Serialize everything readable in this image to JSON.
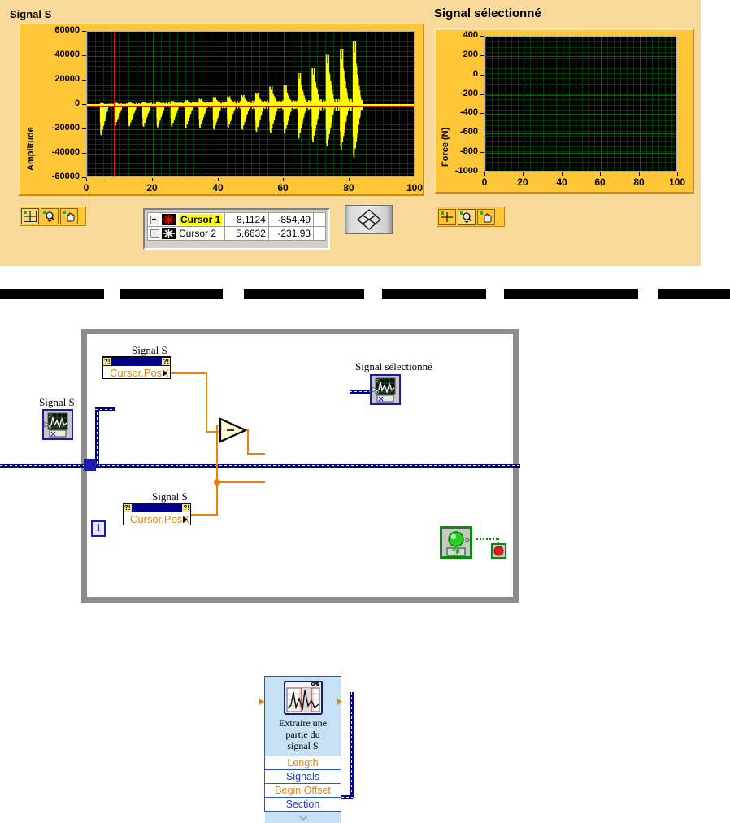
{
  "front_panel": {
    "left_graph": {
      "title": "Signal S",
      "ylabel": "Amplitude",
      "yticks": [
        "60000",
        "40000",
        "20000",
        "0",
        "-20000",
        "-40000",
        "-60000"
      ],
      "xticks": [
        "0",
        "20",
        "40",
        "60",
        "80",
        "100"
      ],
      "ylim": [
        -60000,
        60000
      ],
      "xlim": [
        0,
        100
      ],
      "plot_color": "#FFFF00",
      "bg_color": "#000000",
      "grid_color": "#006400",
      "cursor1_color": "#FF0000",
      "cursor2_color": "#BFEFFF"
    },
    "right_graph": {
      "title": "Signal sélectionné",
      "ylabel": "Force (N)",
      "yticks": [
        "400",
        "200",
        "0",
        "-200",
        "-400",
        "-600",
        "-800",
        "-1000"
      ],
      "xticks": [
        "0",
        "20",
        "40",
        "60",
        "80",
        "100"
      ],
      "ylim": [
        -1000,
        400
      ],
      "xlim": [
        0,
        100
      ],
      "bg_color": "#000000",
      "grid_color": "#006400"
    },
    "left_palette": {
      "tools": [
        "cursor-move-tool",
        "zoom-tool",
        "pan-tool"
      ],
      "selected": "cursor-move-tool"
    },
    "right_palette": {
      "tools": [
        "cursor-move-tool",
        "zoom-tool",
        "pan-tool"
      ],
      "selected": "zoom-tool"
    },
    "cursor_legend": {
      "rows": [
        {
          "name": "Cursor 1",
          "x": "8,1124",
          "y": "-854,49",
          "highlight": true,
          "color": "#FF0000"
        },
        {
          "name": "Cursor 2",
          "x": "5,6632",
          "y": "-231,93",
          "highlight": false,
          "color": "#FFFFFF"
        }
      ]
    },
    "cursor_pad": {
      "name": "cursor-movement-pad"
    }
  },
  "block_diagram": {
    "input_terminal": {
      "label": "Signal S",
      "icon": "waveform-graph-terminal-icon"
    },
    "property_node_1": {
      "label": "Signal S",
      "property": "Cursor.PosX"
    },
    "property_node_2": {
      "label": "Signal S",
      "property": "Cursor.PosX"
    },
    "subtract_node": {
      "symbol": "−",
      "name": "subtract-function"
    },
    "express_vi": {
      "title_lines": [
        "Extraire une",
        "partie du",
        "signal  S"
      ],
      "icon": "extract-signal-icon",
      "terminals": [
        {
          "label": "Length",
          "style": "orange"
        },
        {
          "label": "Signals",
          "style": "blue"
        },
        {
          "label": "Begin Offset",
          "style": "orange"
        },
        {
          "label": "Section",
          "style": "blue"
        }
      ]
    },
    "output_terminal": {
      "label": "Signal sélectionné",
      "icon": "waveform-graph-terminal-icon"
    },
    "iteration_terminal": {
      "label": "i"
    },
    "boolean_terminal": {
      "label": "TF",
      "icon": "green-led-icon"
    },
    "stop_button": {
      "name": "stop-button",
      "icon": "stop-icon",
      "color": "#E01B1B"
    },
    "loop_border_color": "#8C8C8C"
  },
  "chart_data": [
    {
      "type": "line",
      "title": "Signal S",
      "xlabel": "",
      "ylabel": "Amplitude",
      "xlim": [
        0,
        100
      ],
      "ylim": [
        -60000,
        60000
      ],
      "grid": true,
      "legend": "none",
      "annotations": [
        {
          "name": "Cursor 1",
          "x": 8.1124,
          "y": -854.49,
          "color": "#FF0000"
        },
        {
          "name": "Cursor 2",
          "x": 5.6632,
          "y": -231.93,
          "color": "#BFEFFF"
        }
      ],
      "series": [
        {
          "name": "Signal S",
          "color": "#FFFF00",
          "description": "Impact burst train: ~18 periodic bursts between x=4 and x=83 with monotonically increasing envelope.",
          "bursts": [
            {
              "x": 5.0,
              "pos": 1500,
              "neg": -27000
            },
            {
              "x": 9.3,
              "pos": 1800,
              "neg": -18500
            },
            {
              "x": 13.6,
              "pos": 2000,
              "neg": -19000
            },
            {
              "x": 17.9,
              "pos": 2400,
              "neg": -19500
            },
            {
              "x": 22.2,
              "pos": 2800,
              "neg": -20000
            },
            {
              "x": 26.5,
              "pos": 3200,
              "neg": -19500
            },
            {
              "x": 30.8,
              "pos": 4000,
              "neg": -21000
            },
            {
              "x": 35.1,
              "pos": 5000,
              "neg": -20500
            },
            {
              "x": 39.4,
              "pos": 6500,
              "neg": -22000
            },
            {
              "x": 43.7,
              "pos": 7000,
              "neg": -21000
            },
            {
              "x": 48.0,
              "pos": 8000,
              "neg": -22000
            },
            {
              "x": 52.3,
              "pos": 10000,
              "neg": -24000
            },
            {
              "x": 56.6,
              "pos": 15000,
              "neg": -25000
            },
            {
              "x": 60.9,
              "pos": 16000,
              "neg": -26000
            },
            {
              "x": 65.2,
              "pos": 26000,
              "neg": -30000
            },
            {
              "x": 69.5,
              "pos": 30000,
              "neg": -33000
            },
            {
              "x": 73.8,
              "pos": 41000,
              "neg": -37000
            },
            {
              "x": 78.1,
              "pos": 46000,
              "neg": -40000
            },
            {
              "x": 82.0,
              "pos": 52000,
              "neg": -47000
            }
          ],
          "baseline": 0
        }
      ]
    },
    {
      "type": "line",
      "title": "Signal sélectionné",
      "xlabel": "",
      "ylabel": "Force (N)",
      "xlim": [
        0,
        100
      ],
      "ylim": [
        -1000,
        400
      ],
      "grid": true,
      "legend": "none",
      "series": [
        {
          "name": "Signal sélectionné",
          "color": "#FFFF00",
          "values": [],
          "description": "Empty — no data plotted."
        }
      ]
    }
  ]
}
